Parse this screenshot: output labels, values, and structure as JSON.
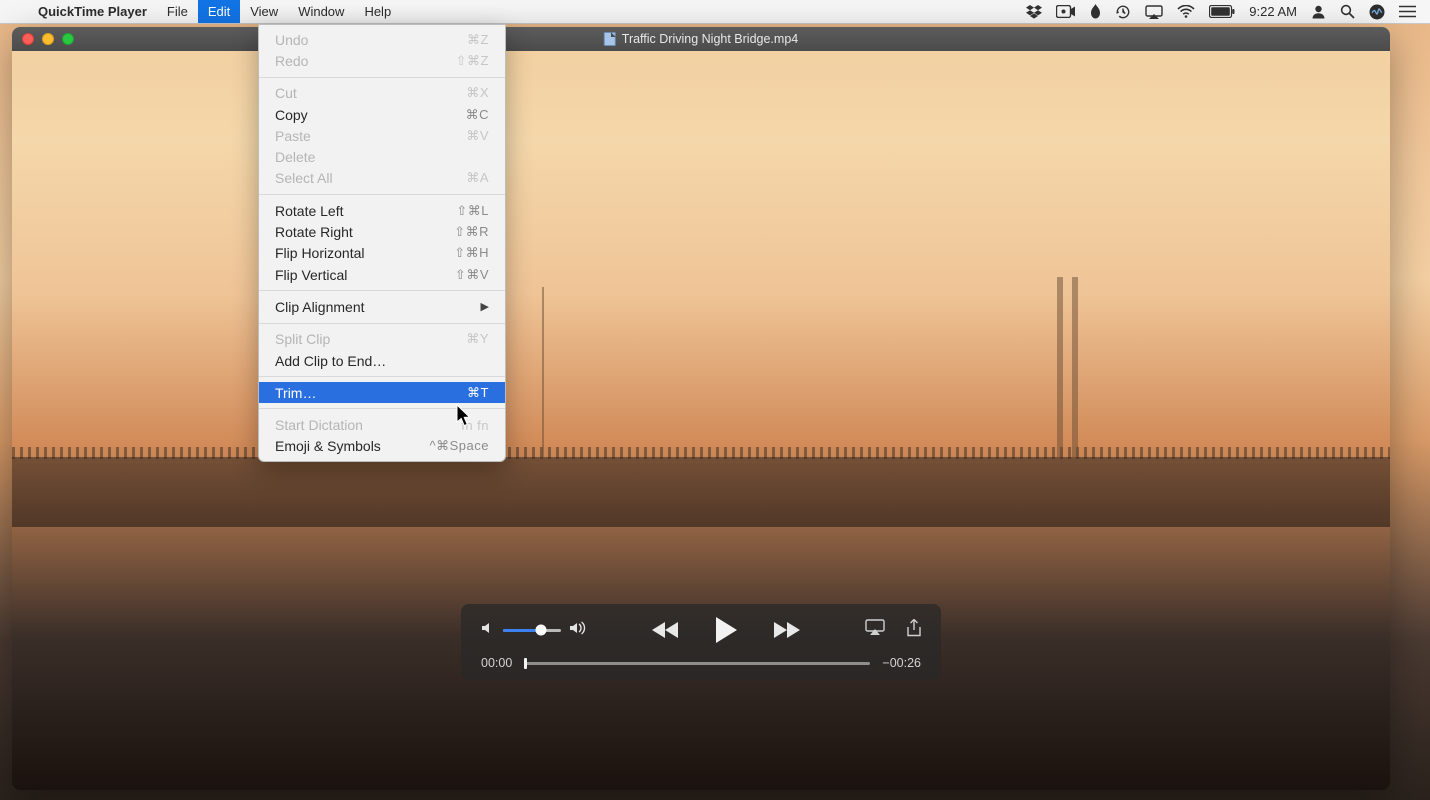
{
  "menubar": {
    "app_name": "QuickTime Player",
    "items": [
      "File",
      "Edit",
      "View",
      "Window",
      "Help"
    ],
    "active_index": 1,
    "clock": "9:22 AM"
  },
  "window": {
    "title": "Traffic Driving Night Bridge.mp4"
  },
  "dropdown": {
    "groups": [
      [
        {
          "label": "Undo",
          "shortcut": "⌘Z",
          "disabled": true
        },
        {
          "label": "Redo",
          "shortcut": "⇧⌘Z",
          "disabled": true
        }
      ],
      [
        {
          "label": "Cut",
          "shortcut": "⌘X",
          "disabled": true
        },
        {
          "label": "Copy",
          "shortcut": "⌘C",
          "disabled": false
        },
        {
          "label": "Paste",
          "shortcut": "⌘V",
          "disabled": true
        },
        {
          "label": "Delete",
          "shortcut": "",
          "disabled": true
        },
        {
          "label": "Select All",
          "shortcut": "⌘A",
          "disabled": true
        }
      ],
      [
        {
          "label": "Rotate Left",
          "shortcut": "⇧⌘L",
          "disabled": false
        },
        {
          "label": "Rotate Right",
          "shortcut": "⇧⌘R",
          "disabled": false
        },
        {
          "label": "Flip Horizontal",
          "shortcut": "⇧⌘H",
          "disabled": false
        },
        {
          "label": "Flip Vertical",
          "shortcut": "⇧⌘V",
          "disabled": false
        }
      ],
      [
        {
          "label": "Clip Alignment",
          "shortcut": "",
          "disabled": false,
          "submenu": true
        }
      ],
      [
        {
          "label": "Split Clip",
          "shortcut": "⌘Y",
          "disabled": true
        },
        {
          "label": "Add Clip to End…",
          "shortcut": "",
          "disabled": false
        }
      ],
      [
        {
          "label": "Trim…",
          "shortcut": "⌘T",
          "disabled": false,
          "selected": true
        }
      ],
      [
        {
          "label": "Start Dictation",
          "shortcut": "fn fn",
          "disabled": true
        },
        {
          "label": "Emoji & Symbols",
          "shortcut": "^⌘Space",
          "disabled": false
        }
      ]
    ]
  },
  "hud": {
    "time_elapsed": "00:00",
    "time_remaining": "−00:26",
    "volume_percent": 66
  },
  "menu_icons": {
    "dropbox": "dropbox-icon",
    "camera": "camera-icon",
    "flame": "backblaze-icon",
    "timemachine": "timemachine-icon",
    "airplay": "airplay-icon",
    "wifi": "wifi-icon",
    "battery": "battery-icon",
    "user": "user-icon",
    "spotlight": "spotlight-icon",
    "siri": "siri-icon",
    "notif": "notification-center-icon"
  }
}
